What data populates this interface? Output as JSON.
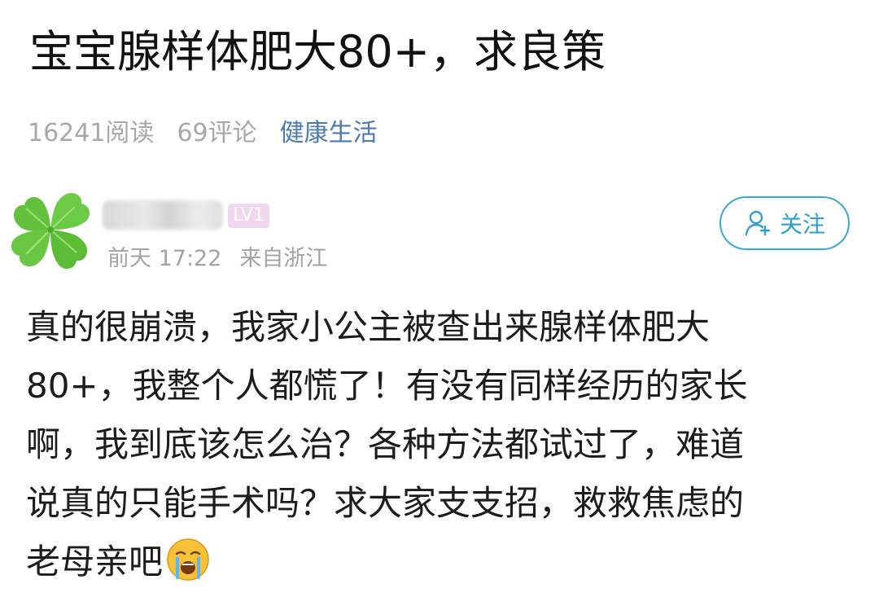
{
  "post": {
    "title": "宝宝腺样体肥大80+，求良策",
    "reads": "16241阅读",
    "comments": "69评论",
    "category": "健康生活"
  },
  "author": {
    "level": "LV1",
    "time": "前天 17:22",
    "location": "来自浙江",
    "avatar_icon": "four-leaf-clover-icon"
  },
  "follow": {
    "label": "关注",
    "icon": "add-user-icon",
    "color": "#2f9fd2"
  },
  "content": {
    "lines": [
      "真的很崩溃，我家小公主被查出来腺样体肥大",
      "80+，我整个人都慌了！有没有同样经历的家长",
      "啊，我到底该怎么治？各种方法都试过了，难道",
      "说真的只能手术吗？求大家支支招，救救焦虑的",
      "老母亲吧"
    ],
    "emoji": "crying-face-icon"
  },
  "colors": {
    "category": "#4a79b3",
    "meta": "#a8a8a8",
    "level_badge": "#f3d7ee",
    "clover": "#63c23c"
  }
}
